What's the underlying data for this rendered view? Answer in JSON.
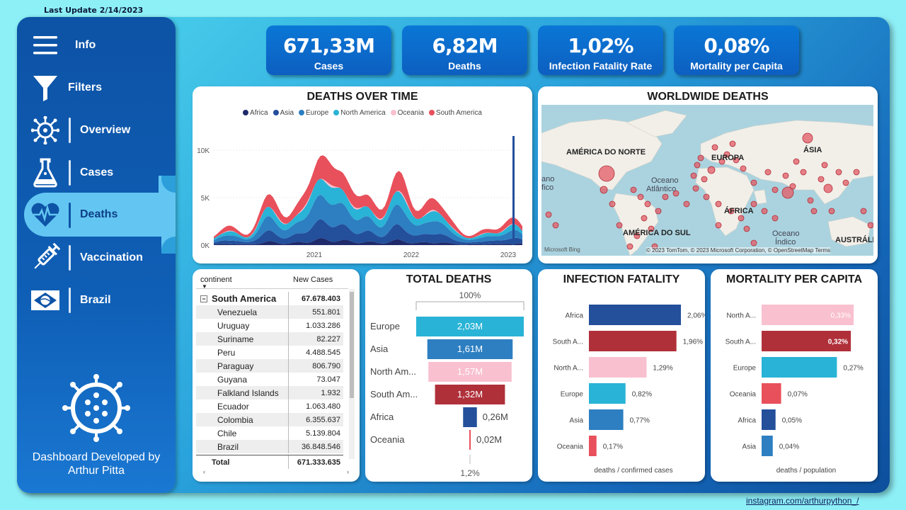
{
  "header": {
    "last_update": "Last Update 2/14/2023"
  },
  "sidebar": {
    "items": [
      {
        "label": "Info",
        "icon": "menu-icon"
      },
      {
        "label": "Filters",
        "icon": "filter-icon"
      },
      {
        "label": "Overview",
        "icon": "virus-icon"
      },
      {
        "label": "Cases",
        "icon": "flask-icon"
      },
      {
        "label": "Deaths",
        "icon": "heartbeat-icon",
        "active": true
      },
      {
        "label": "Vaccination",
        "icon": "syringe-icon"
      },
      {
        "label": "Brazil",
        "icon": "brazil-flag-icon"
      }
    ],
    "credit_line1": "Dashboard Developed by",
    "credit_line2": "Arthur Pitta"
  },
  "kpis": [
    {
      "value": "671,33M",
      "label": "Cases"
    },
    {
      "value": "6,82M",
      "label": "Deaths"
    },
    {
      "value": "1,02%",
      "label": "Infection Fatality Rate"
    },
    {
      "value": "0,08%",
      "label": "Mortality per Capita"
    }
  ],
  "deaths_over_time": {
    "title": "DEATHS OVER TIME",
    "legend": [
      {
        "name": "Africa",
        "color": "#1f2a6b"
      },
      {
        "name": "Asia",
        "color": "#234f9b"
      },
      {
        "name": "Europe",
        "color": "#2d7fc1"
      },
      {
        "name": "North America",
        "color": "#29b3d6"
      },
      {
        "name": "Oceania",
        "color": "#f9c0cf"
      },
      {
        "name": "South America",
        "color": "#e8505b"
      }
    ],
    "y_ticks": [
      "10K",
      "5K",
      "0K"
    ],
    "x_ticks": [
      "2021",
      "2022",
      "2023"
    ]
  },
  "map": {
    "title": "WORLDWIDE DEATHS",
    "labels": [
      "AMÉRICA DO NORTE",
      "EUROPA",
      "ÁSIA",
      "ÁFRICA",
      "AMÉRICA DO SUL",
      "AUSTRÁLIA",
      "Oceano Atlântico",
      "Oceano Índico",
      "ano",
      "fico"
    ],
    "attribution": "© 2023 TomTom, © 2023 Microsoft Corporation, © OpenStreetMap  Terms",
    "brand": "Microsoft Bing"
  },
  "table": {
    "col1": "continent",
    "col2": "New Cases",
    "group": {
      "name": "South America",
      "value": "67.678.403"
    },
    "rows": [
      {
        "name": "Venezuela",
        "value": "551.801"
      },
      {
        "name": "Uruguay",
        "value": "1.033.286"
      },
      {
        "name": "Suriname",
        "value": "82.227"
      },
      {
        "name": "Peru",
        "value": "4.488.545"
      },
      {
        "name": "Paraguay",
        "value": "806.790"
      },
      {
        "name": "Guyana",
        "value": "73.047"
      },
      {
        "name": "Falkland Islands",
        "value": "1.932"
      },
      {
        "name": "Ecuador",
        "value": "1.063.480"
      },
      {
        "name": "Colombia",
        "value": "6.355.637"
      },
      {
        "name": "Chile",
        "value": "5.139.804"
      },
      {
        "name": "Brazil",
        "value": "36.848.546"
      }
    ],
    "total_label": "Total",
    "total_value": "671.333.635"
  },
  "chart_data": [
    {
      "type": "bar",
      "title": "TOTAL DEATHS",
      "top_label": "100%",
      "bottom_label": "1,2%",
      "categories": [
        "Europe",
        "Asia",
        "North Am...",
        "South Am...",
        "Africa",
        "Oceania"
      ],
      "values": [
        2.03,
        1.61,
        1.57,
        1.32,
        0.26,
        0.02
      ],
      "value_labels": [
        "2,03M",
        "1,61M",
        "1,57M",
        "1,32M",
        "0,26M",
        "0,02M"
      ],
      "colors": [
        "#29b3d6",
        "#2d7fc1",
        "#f9c0cf",
        "#b0303a",
        "#234f9b",
        "#e8505b"
      ]
    },
    {
      "type": "bar",
      "title": "INFECTION FATALITY",
      "xlabel": "deaths / confirmed cases",
      "categories": [
        "Africa",
        "South A...",
        "North A...",
        "Europe",
        "Asia",
        "Oceania"
      ],
      "values": [
        2.06,
        1.96,
        1.29,
        0.82,
        0.77,
        0.17
      ],
      "value_labels": [
        "2,06%",
        "1,96%",
        "1,29%",
        "0,82%",
        "0,77%",
        "0,17%"
      ],
      "colors": [
        "#234f9b",
        "#b0303a",
        "#f9c0cf",
        "#29b3d6",
        "#2d7fc1",
        "#e8505b"
      ]
    },
    {
      "type": "bar",
      "title": "MORTALITY PER CAPITA",
      "xlabel": "deaths / population",
      "categories": [
        "North A...",
        "South A...",
        "Europe",
        "Oceania",
        "Africa",
        "Asia"
      ],
      "values": [
        0.33,
        0.32,
        0.27,
        0.07,
        0.05,
        0.04
      ],
      "value_labels": [
        "0,33%",
        "0,32%",
        "0,27%",
        "0,07%",
        "0,05%",
        "0,04%"
      ],
      "colors": [
        "#f9c0cf",
        "#b0303a",
        "#29b3d6",
        "#e8505b",
        "#234f9b",
        "#2d7fc1"
      ]
    }
  ],
  "footer": {
    "link": "instagram.com/arthurpython_/"
  }
}
